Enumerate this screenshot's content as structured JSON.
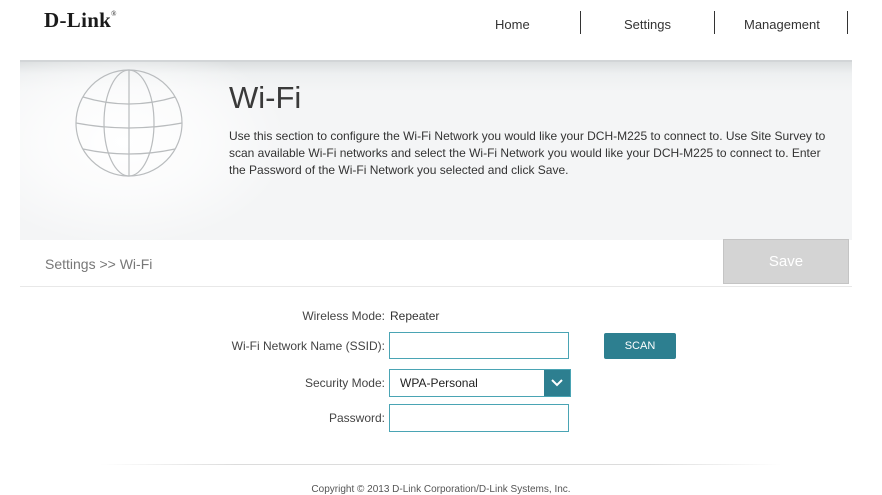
{
  "brand": {
    "logo_text": "D-Link",
    "logo_mark": "®"
  },
  "nav": {
    "home": "Home",
    "settings": "Settings",
    "management": "Management"
  },
  "hero": {
    "title": "Wi-Fi",
    "description": "Use this section to configure the Wi-Fi Network you would like your DCH-M225 to connect to. Use Site Survey to scan available Wi-Fi networks and select the Wi-Fi Network you would like your DCH-M225 to connect to. Enter the Password of the Wi-Fi Network you selected and click Save.",
    "icon": "globe-icon"
  },
  "breadcrumb": {
    "text": "Settings >> Wi-Fi"
  },
  "toolbar": {
    "save_label": "Save"
  },
  "form": {
    "wireless_mode_label": "Wireless Mode:",
    "wireless_mode_value": "Repeater",
    "ssid_label": "Wi-Fi Network Name (SSID):",
    "ssid_value": "",
    "scan_label": "SCAN",
    "security_mode_label": "Security Mode:",
    "security_mode_value": "WPA-Personal",
    "password_label": "Password:",
    "password_value": ""
  },
  "footer": {
    "copyright": "Copyright © 2013 D-Link Corporation/D-Link Systems, Inc."
  },
  "colors": {
    "accent": "#2d7f90",
    "input_border": "#4aa4b4",
    "save_disabled": "#d4d4d4"
  }
}
